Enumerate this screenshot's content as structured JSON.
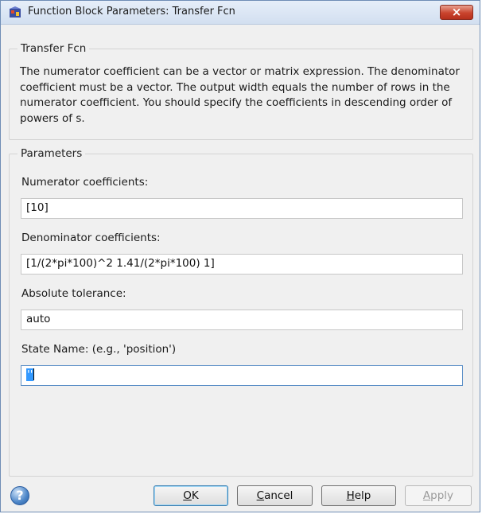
{
  "window": {
    "title": "Function Block Parameters: Transfer Fcn",
    "close_glyph": "×"
  },
  "block_group": {
    "title": "Transfer Fcn",
    "description": "The numerator coefficient can be a vector or matrix expression. The denominator coefficient must be a vector. The output width equals the number of rows in the numerator coefficient. You should specify the coefficients in descending order of powers of s."
  },
  "parameters_group": {
    "title": "Parameters",
    "numerator": {
      "label": "Numerator coefficients:",
      "value": "[10]"
    },
    "denominator": {
      "label": "Denominator coefficients:",
      "value": "[1/(2*pi*100)^2 1.41/(2*pi*100) 1]"
    },
    "abs_tolerance": {
      "label": "Absolute tolerance:",
      "value": "auto"
    },
    "state_name": {
      "label": "State Name: (e.g., 'position')",
      "value": "''"
    }
  },
  "buttons": {
    "help_icon_glyph": "?",
    "ok_mnemonic": "O",
    "ok_rest": "K",
    "cancel_mnemonic": "C",
    "cancel_rest": "ancel",
    "help_mnemonic": "H",
    "help_rest": "elp",
    "apply_mnemonic": "A",
    "apply_rest": "pply"
  },
  "colors": {
    "close_button": "#c9432d",
    "default_button_border": "#3c7fb1",
    "selection": "#3399ff"
  },
  "icons": {
    "app": "simulink-block-icon",
    "help": "help-icon",
    "close": "close-icon"
  }
}
